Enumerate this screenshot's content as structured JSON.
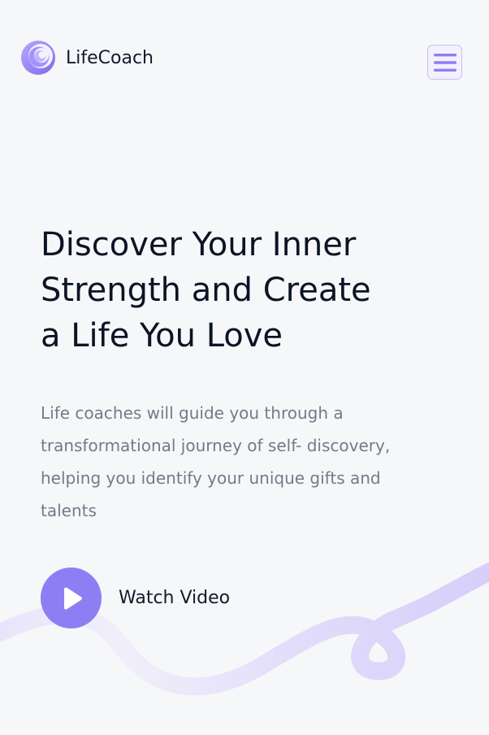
{
  "header": {
    "brand": "LifeCoach",
    "logo_icon": "concentric-swirl-logo-icon",
    "menu_icon": "hamburger-menu-icon"
  },
  "hero": {
    "title_lines": [
      "Discover Your Inner",
      "Strength and Create",
      "a Life You Love"
    ],
    "description_lines": [
      "Life coaches will guide you through a",
      "transformational journey of self- discovery,",
      "helping you identify your unique gifts and",
      "talents"
    ],
    "watch_label": "Watch Video",
    "play_icon": "play-icon"
  },
  "colors": {
    "accent": "#8f7df4",
    "background": "#f6f7f9",
    "heading": "#0b1424",
    "body_text": "#737b88"
  }
}
